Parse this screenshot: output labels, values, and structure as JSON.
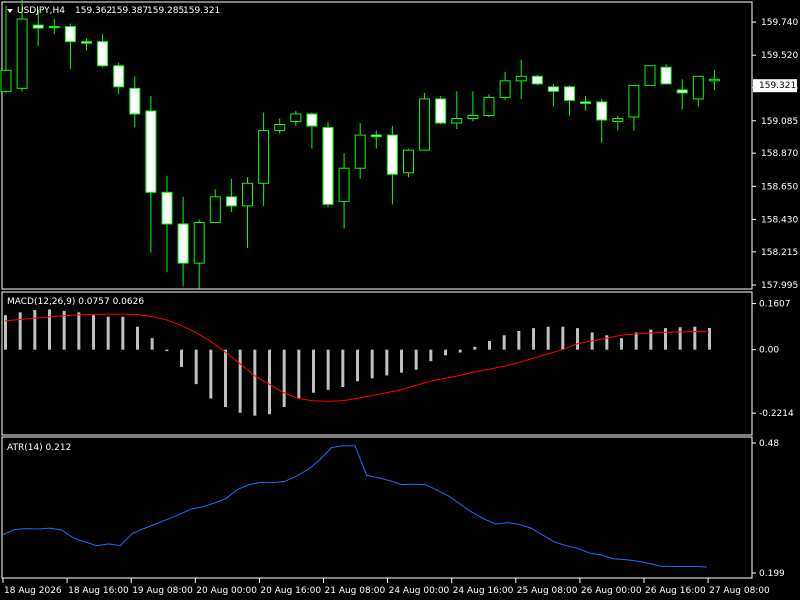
{
  "chart_data": [
    {
      "type": "candlestick",
      "title": "USDJPY,H4",
      "ohlc_readout": [
        "159.362",
        "159.387",
        "159.285",
        "159.321"
      ],
      "current_price": 159.321,
      "current_price_label": "159.321",
      "ylim": [
        157.995,
        159.84
      ],
      "y_ticks": [
        "159.740",
        "159.520",
        "159.305",
        "159.085",
        "158.870",
        "158.650",
        "158.430",
        "158.215",
        "157.995"
      ],
      "colors": {
        "bull_body": "#000000",
        "bear_body": "#ffffff",
        "wick": "#00ff00",
        "axis": "#ffffff",
        "background": "#000000"
      },
      "candles": [
        [
          159.28,
          159.85,
          159.42,
          159.27
        ],
        [
          159.3,
          159.89,
          159.76,
          159.28
        ],
        [
          159.72,
          159.82,
          159.7,
          159.58
        ],
        [
          159.71,
          159.76,
          159.71,
          159.66
        ],
        [
          159.71,
          159.73,
          159.61,
          159.43
        ],
        [
          159.61,
          159.63,
          159.6,
          159.55
        ],
        [
          159.61,
          159.66,
          159.45,
          159.44
        ],
        [
          159.45,
          159.47,
          159.31,
          159.26
        ],
        [
          159.3,
          159.38,
          159.13,
          159.04
        ],
        [
          159.15,
          159.25,
          158.61,
          158.21
        ],
        [
          158.61,
          158.72,
          158.4,
          158.08
        ],
        [
          158.4,
          158.58,
          158.14,
          157.99
        ],
        [
          158.14,
          158.43,
          158.41,
          157.97
        ],
        [
          158.41,
          158.63,
          158.58,
          158.42
        ],
        [
          158.58,
          158.7,
          158.52,
          158.48
        ],
        [
          158.52,
          158.71,
          158.67,
          158.24
        ],
        [
          158.67,
          159.14,
          159.02,
          158.52
        ],
        [
          159.02,
          159.1,
          159.06,
          159.0
        ],
        [
          159.08,
          159.15,
          159.13,
          159.05
        ],
        [
          159.13,
          159.14,
          159.05,
          158.9
        ],
        [
          159.04,
          159.08,
          158.53,
          158.51
        ],
        [
          158.55,
          158.87,
          158.77,
          158.37
        ],
        [
          158.77,
          159.07,
          158.99,
          158.7
        ],
        [
          158.99,
          159.02,
          158.98,
          158.9
        ],
        [
          158.99,
          159.05,
          158.73,
          158.53
        ],
        [
          158.74,
          158.9,
          158.89,
          158.71
        ],
        [
          158.89,
          159.27,
          159.23,
          158.89
        ],
        [
          159.23,
          159.25,
          159.07,
          159.06
        ],
        [
          159.07,
          159.28,
          159.1,
          159.03
        ],
        [
          159.1,
          159.28,
          159.12,
          159.08
        ],
        [
          159.12,
          159.26,
          159.24,
          159.11
        ],
        [
          159.24,
          159.41,
          159.35,
          159.22
        ],
        [
          159.35,
          159.49,
          159.38,
          159.23
        ],
        [
          159.38,
          159.39,
          159.33,
          159.32
        ],
        [
          159.31,
          159.33,
          159.28,
          159.18
        ],
        [
          159.31,
          159.32,
          159.22,
          159.12
        ],
        [
          159.21,
          159.25,
          159.2,
          159.15
        ],
        [
          159.21,
          159.23,
          159.09,
          158.94
        ],
        [
          159.08,
          159.12,
          159.1,
          159.02
        ],
        [
          159.11,
          159.31,
          159.32,
          159.02
        ],
        [
          159.32,
          159.33,
          159.45,
          159.41
        ],
        [
          159.44,
          159.46,
          159.33,
          159.33
        ],
        [
          159.29,
          159.36,
          159.27,
          159.16
        ],
        [
          159.23,
          159.36,
          159.38,
          159.18
        ],
        [
          159.35,
          159.42,
          159.36,
          159.29
        ]
      ]
    },
    {
      "type": "histogram+line",
      "title": "MACD(12,26,9) 0.0757 0.0626",
      "ylim": [
        -0.28,
        0.18
      ],
      "y_ticks": [
        "0.1607",
        "0.00",
        "-0.2214"
      ],
      "colors": {
        "histogram": "#c0c0c0",
        "signal": "#ff0000"
      },
      "macd": [
        0.12,
        0.13,
        0.138,
        0.14,
        0.135,
        0.13,
        0.12,
        0.115,
        0.115,
        0.08,
        0.04,
        -0.005,
        -0.06,
        -0.12,
        -0.17,
        -0.2,
        -0.22,
        -0.23,
        -0.225,
        -0.2,
        -0.17,
        -0.15,
        -0.14,
        -0.13,
        -0.11,
        -0.1,
        -0.09,
        -0.08,
        -0.07,
        -0.04,
        -0.02,
        -0.01,
        0.01,
        0.03,
        0.05,
        0.065,
        0.075,
        0.08,
        0.08,
        0.075,
        0.06,
        0.05,
        0.04,
        0.06,
        0.07,
        0.075,
        0.078,
        0.08,
        0.0757
      ],
      "signal": [
        0.1,
        0.105,
        0.11,
        0.114,
        0.118,
        0.121,
        0.123,
        0.124,
        0.124,
        0.122,
        0.116,
        0.104,
        0.085,
        0.06,
        0.03,
        -0.008,
        -0.048,
        -0.09,
        -0.12,
        -0.15,
        -0.17,
        -0.178,
        -0.18,
        -0.178,
        -0.17,
        -0.16,
        -0.15,
        -0.14,
        -0.125,
        -0.11,
        -0.1,
        -0.09,
        -0.078,
        -0.068,
        -0.058,
        -0.045,
        -0.03,
        -0.015,
        0.0,
        0.02,
        0.03,
        0.04,
        0.05,
        0.055,
        0.058,
        0.06,
        0.062,
        0.063,
        0.0626
      ]
    },
    {
      "type": "line",
      "title": "ATR(14) 0.212",
      "ylim": [
        0.199,
        0.48
      ],
      "y_ticks": [
        "0.48",
        "0.199"
      ],
      "colors": {
        "line": "#1e6bff"
      },
      "values": [
        0.282,
        0.293,
        0.295,
        0.294,
        0.296,
        0.292,
        0.275,
        0.266,
        0.258,
        0.262,
        0.258,
        0.284,
        0.295,
        0.305,
        0.315,
        0.325,
        0.337,
        0.342,
        0.35,
        0.36,
        0.38,
        0.39,
        0.395,
        0.394,
        0.397,
        0.408,
        0.423,
        0.444,
        0.47,
        0.474,
        0.474,
        0.41,
        0.405,
        0.398,
        0.39,
        0.391,
        0.39,
        0.378,
        0.365,
        0.347,
        0.33,
        0.316,
        0.305,
        0.308,
        0.304,
        0.296,
        0.281,
        0.266,
        0.258,
        0.252,
        0.242,
        0.238,
        0.23,
        0.228,
        0.225,
        0.22,
        0.214,
        0.213,
        0.213,
        0.213,
        0.212
      ]
    }
  ],
  "x_axis_labels": [
    "18 Aug 2026",
    "18 Aug 16:00",
    "19 Aug 08:00",
    "20 Aug 00:00",
    "20 Aug 16:00",
    "21 Aug 08:00",
    "24 Aug 00:00",
    "24 Aug 16:00",
    "25 Aug 08:00",
    "26 Aug 00:00",
    "26 Aug 16:00",
    "27 Aug 08:00"
  ]
}
